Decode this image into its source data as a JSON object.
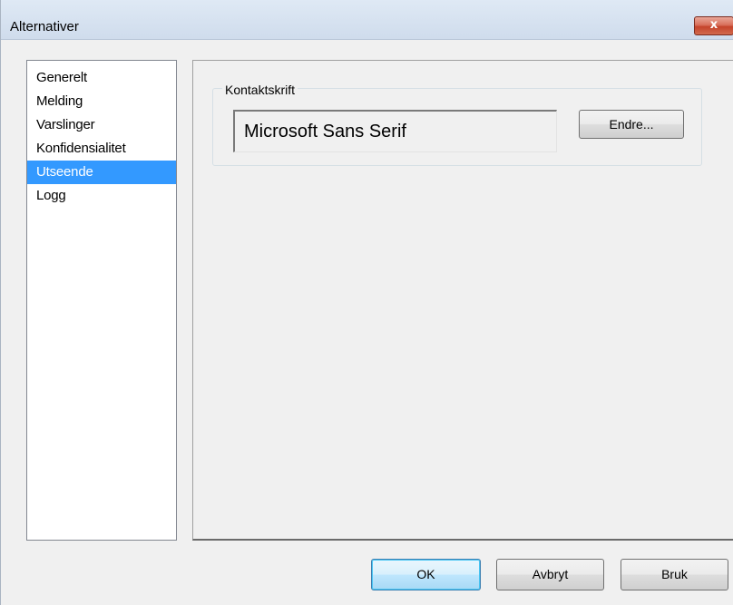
{
  "window": {
    "title": "Alternativer",
    "close_glyph": "x"
  },
  "sidebar": {
    "items": [
      {
        "label": "Generelt",
        "selected": false
      },
      {
        "label": "Melding",
        "selected": false
      },
      {
        "label": "Varslinger",
        "selected": false
      },
      {
        "label": "Konfidensialitet",
        "selected": false
      },
      {
        "label": "Utseende",
        "selected": true
      },
      {
        "label": "Logg",
        "selected": false
      }
    ]
  },
  "appearance": {
    "group_label": "Kontaktskrift",
    "font_value": "Microsoft Sans Serif",
    "change_button": "Endre..."
  },
  "footer": {
    "ok": "OK",
    "cancel": "Avbryt",
    "apply": "Bruk"
  },
  "colors": {
    "selection": "#3399ff",
    "close_button": "#c4432b"
  }
}
